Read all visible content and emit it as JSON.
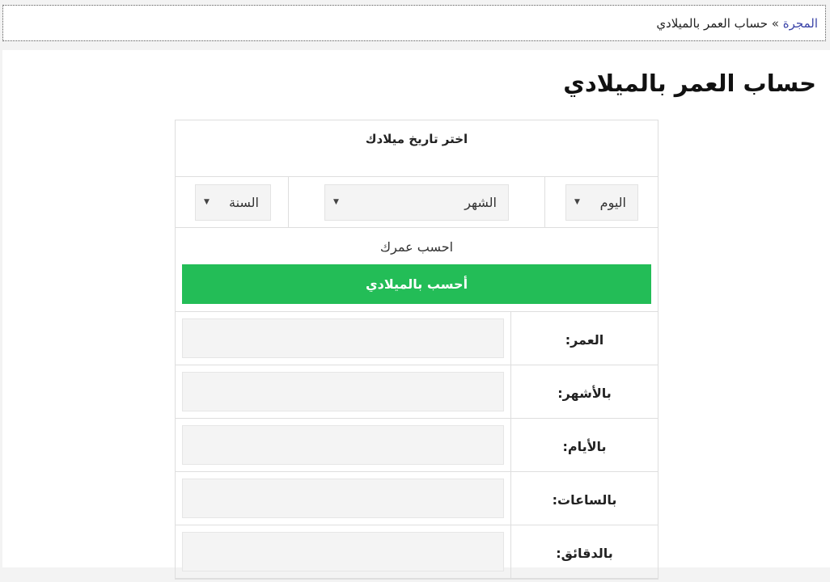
{
  "breadcrumb": {
    "home": "المجرة",
    "separator": "»",
    "current": "حساب العمر بالميلادي"
  },
  "page": {
    "title": "حساب العمر بالميلادي"
  },
  "calculator": {
    "header": "اختر تاريخ ميلادك",
    "day_select": "اليوم",
    "month_select": "الشهر",
    "year_select": "السنة",
    "prompt": "احسب عمرك",
    "button": "أحسب بالميلادي",
    "button_color": "#23bd57",
    "results": [
      {
        "label": "العمر:",
        "value": ""
      },
      {
        "label": "بالأشهر:",
        "value": ""
      },
      {
        "label": "بالأيام:",
        "value": ""
      },
      {
        "label": "بالساعات:",
        "value": ""
      },
      {
        "label": "بالدقائق:",
        "value": ""
      }
    ]
  }
}
